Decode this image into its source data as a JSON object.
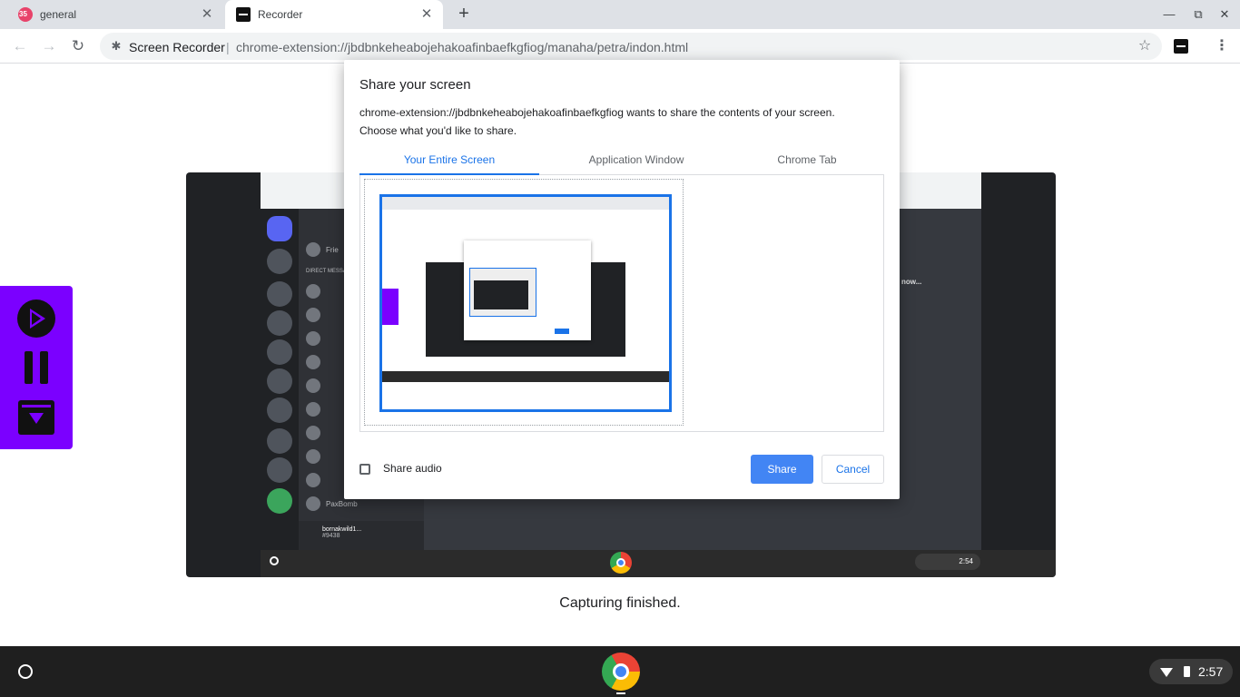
{
  "browser": {
    "tabs": [
      {
        "label": "general",
        "favicon": "discord-icon",
        "badge": "35",
        "active": false
      },
      {
        "label": "Recorder",
        "favicon": "recorder-icon",
        "active": true
      }
    ],
    "new_tab_icon": "+",
    "window_controls": {
      "minimize": "—",
      "restore": "⧉",
      "close": "✕"
    },
    "toolbar": {
      "back_icon": "←",
      "forward_icon": "→",
      "reload_icon": "↻",
      "site_name": "Screen Recorder",
      "separator": "|",
      "url": "chrome-extension://jbdbnkeheabojehakoafinbaefkgfiog/manaha/petra/indon.html",
      "star_icon": "☆",
      "menu_icon": "⋮"
    }
  },
  "page": {
    "status_text": "Capturing finished.",
    "preview": {
      "window_title": "Discord",
      "dm_header": "DIRECT MESSAGES",
      "friends_label": "Frie",
      "user_name": "bornakwild1...",
      "user_tag": "#9438",
      "last_dm": "PaxBomb",
      "right_heading": "now...",
      "clock": "2:54"
    }
  },
  "recorder_panel": {
    "play_icon": "play-icon",
    "pause_icon": "pause-icon",
    "save_icon": "download-icon"
  },
  "share_dialog": {
    "title": "Share your screen",
    "description_line1": "chrome-extension://jbdbnkeheabojehakoafinbaefkgfiog wants to share the contents of your screen.",
    "description_line2": "Choose what you'd like to share.",
    "tabs": [
      {
        "label": "Your Entire Screen",
        "active": true
      },
      {
        "label": "Application Window",
        "active": false
      },
      {
        "label": "Chrome Tab",
        "active": false
      }
    ],
    "share_audio_label": "Share audio",
    "share_audio_checked": false,
    "share_button": "Share",
    "cancel_button": "Cancel",
    "accent_color": "#1a73e8"
  },
  "shelf": {
    "time": "2:57"
  },
  "colors": {
    "recorder_purple": "#7b00ff",
    "discord_dark": "#36393f"
  }
}
